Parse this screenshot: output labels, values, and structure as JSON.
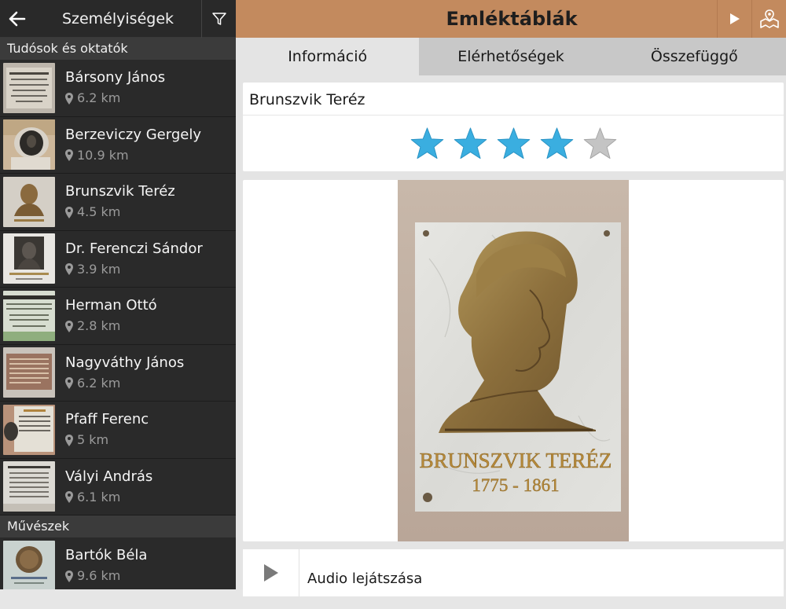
{
  "sidebar": {
    "title": "Személyiségek",
    "sections": [
      {
        "header": "Tudósok és oktatók",
        "items": [
          {
            "name": "Bársony János",
            "distance": "6.2 km"
          },
          {
            "name": "Berzeviczy Gergely",
            "distance": "10.9 km"
          },
          {
            "name": "Brunszvik Teréz",
            "distance": "4.5 km"
          },
          {
            "name": "Dr. Ferenczi Sándor",
            "distance": "3.9 km"
          },
          {
            "name": "Herman Ottó",
            "distance": "2.8 km"
          },
          {
            "name": "Nagyváthy János",
            "distance": "6.2 km"
          },
          {
            "name": "Pfaff Ferenc",
            "distance": "5 km"
          },
          {
            "name": "Vályi András",
            "distance": "6.1 km"
          }
        ]
      },
      {
        "header": "Művészek",
        "items": [
          {
            "name": "Bartók Béla",
            "distance": "9.6 km"
          }
        ]
      }
    ]
  },
  "header": {
    "title": "Emléktáblák"
  },
  "tabs": [
    "Információ",
    "Elérhetőségek",
    "Összefüggő"
  ],
  "detail": {
    "title": "Brunszvik Teréz",
    "rating": 4,
    "rating_max": 5,
    "plaque_name": "BRUNSZVIK TERÉZ",
    "plaque_years": "1775 - 1861",
    "audio_label": "Audio lejátszása"
  },
  "colors": {
    "accent": "#c38a5e",
    "star_active": "#3aaee0",
    "star_inactive": "#b5b5b5"
  }
}
